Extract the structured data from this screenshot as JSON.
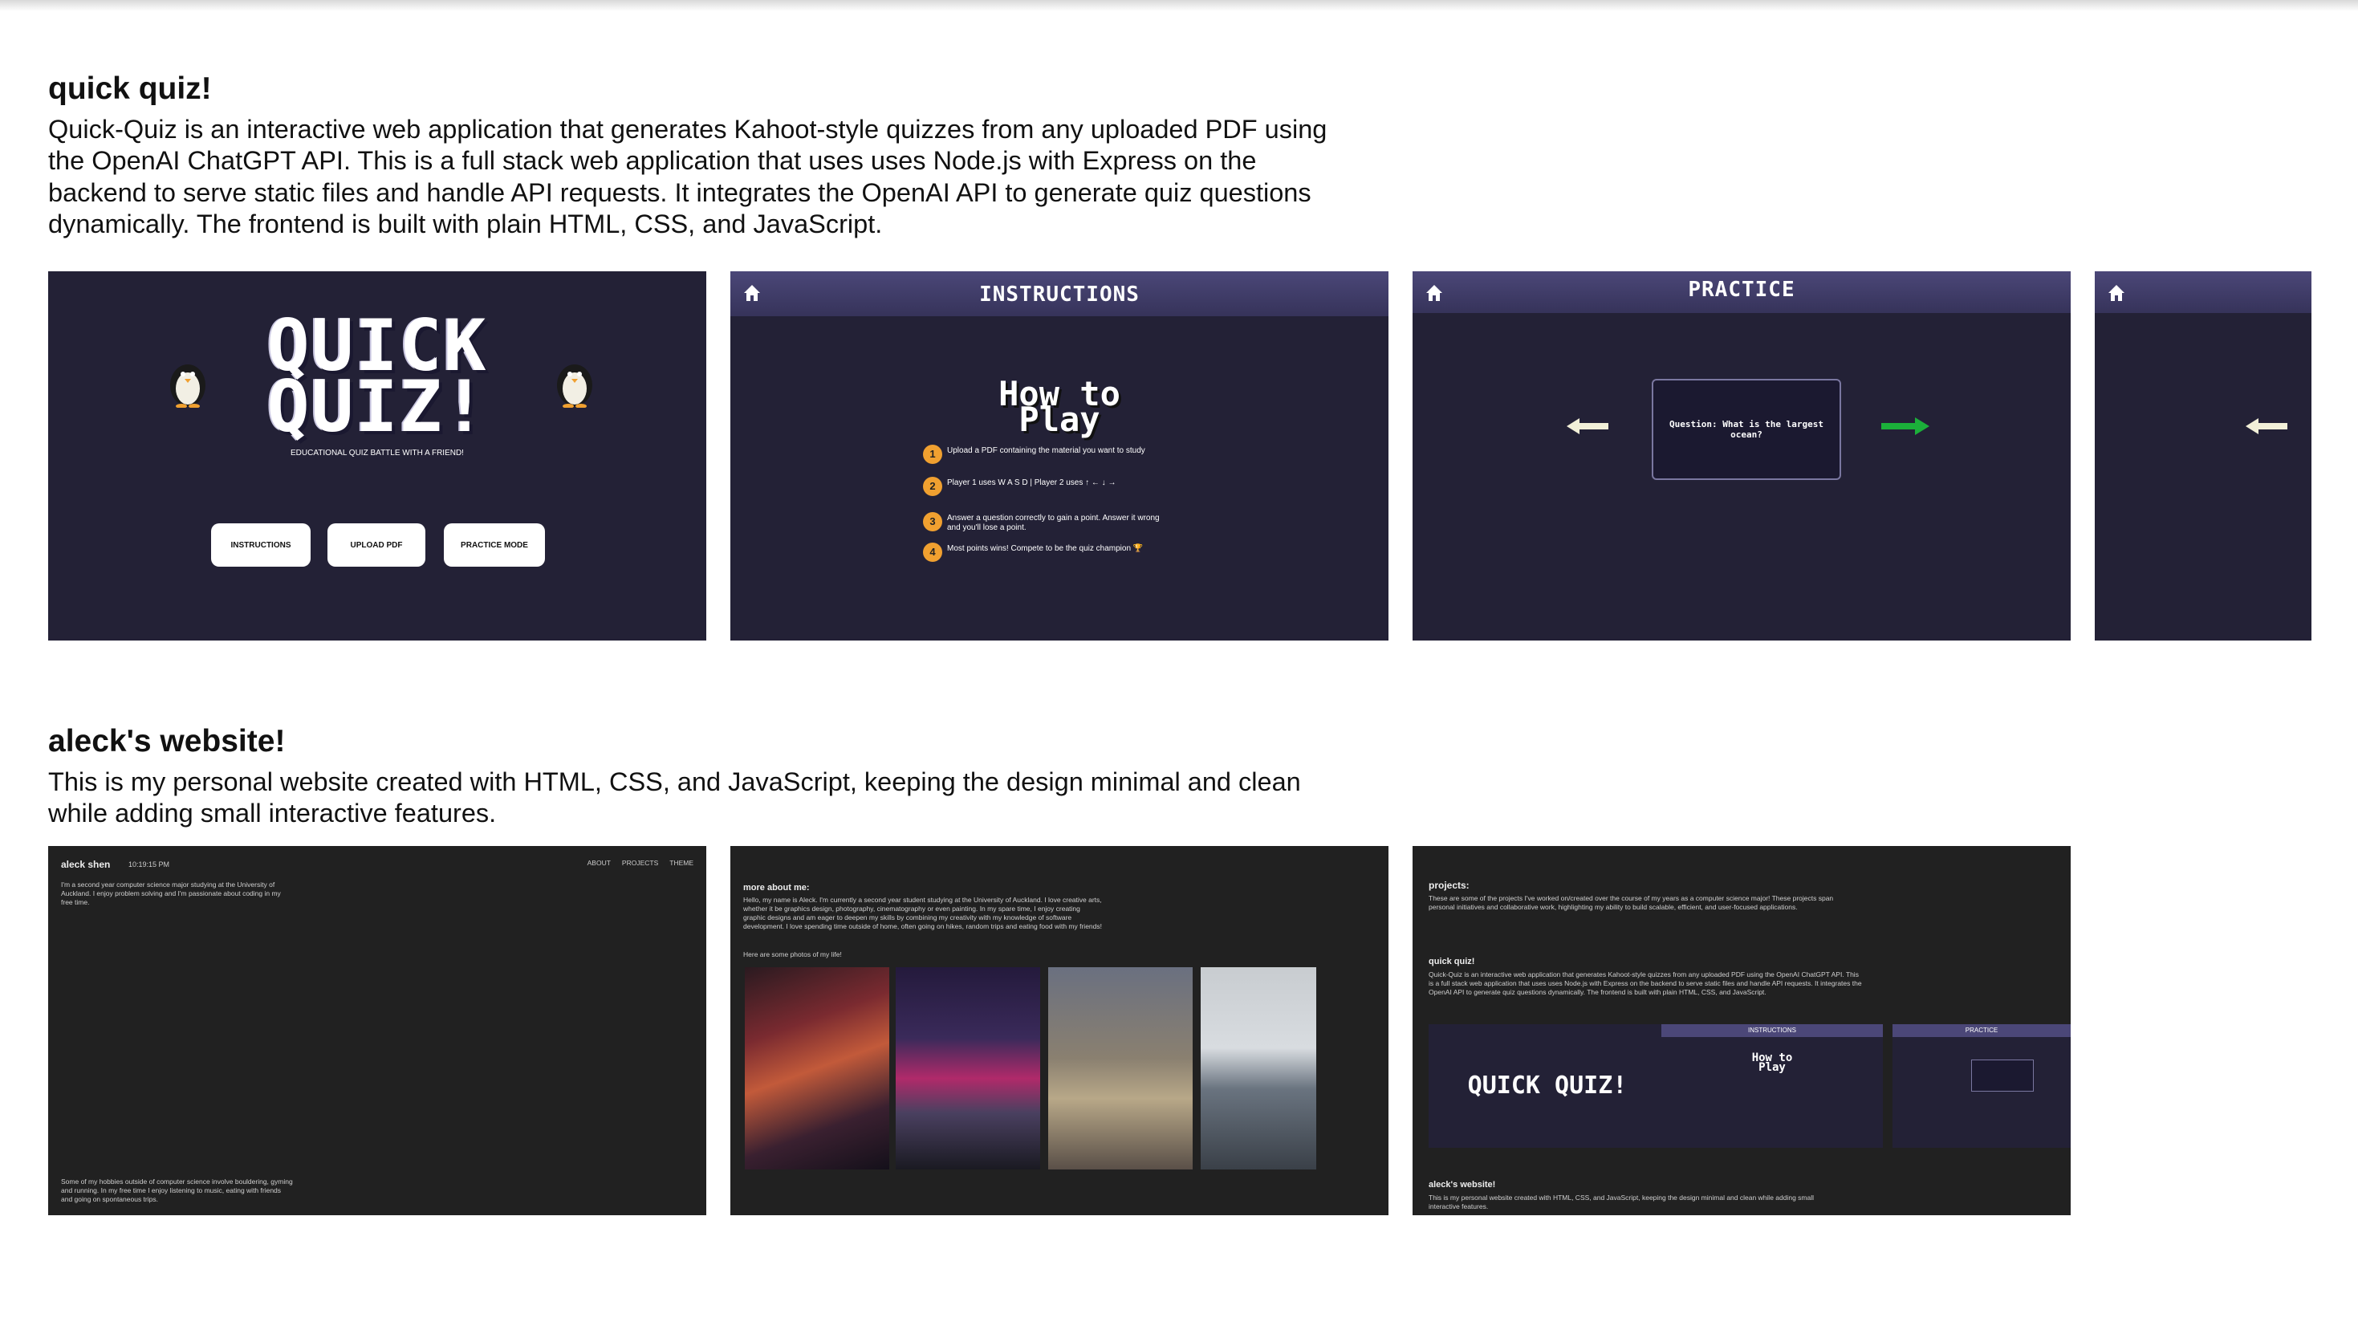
{
  "projects": [
    {
      "title": "quick quiz!",
      "description": "Quick-Quiz is an interactive web application that generates Kahoot-style quizzes from any uploaded PDF using the OpenAI ChatGPT API. This is a full stack web application that uses uses Node.js with Express on the backend to serve static files and handle API requests. It integrates the OpenAI API to generate quiz questions dynamically. The frontend is built with plain HTML, CSS, and JavaScript.",
      "screens": {
        "home": {
          "title": "QUICK QUIZ!",
          "subtitle": "EDUCATIONAL QUIZ BATTLE WITH A FRIEND!",
          "buttons": [
            "INSTRUCTIONS",
            "UPLOAD PDF",
            "PRACTICE MODE"
          ]
        },
        "instructions": {
          "header": "INSTRUCTIONS",
          "heading": "How to Play",
          "steps": [
            "Upload a PDF containing the material you want to study",
            "Player 1 uses W A S D  |  Player 2 uses ↑ ← ↓ →",
            "Answer a question correctly to gain a point. Answer it wrong and you'll lose a point.",
            "Most points wins! Compete to be the quiz champion 🏆"
          ],
          "step_numbers": [
            "1",
            "2",
            "3",
            "4"
          ]
        },
        "practice": {
          "header": "PRACTICE",
          "question": "Question: What is the largest ocean?"
        }
      }
    },
    {
      "title": "aleck's website!",
      "description": "This is my personal website created with HTML, CSS, and JavaScript, keeping the design minimal and clean while adding small interactive features.",
      "screens": {
        "home": {
          "name": "aleck shen",
          "time": "10:19:15 PM",
          "nav": [
            "ABOUT",
            "PROJECTS",
            "THEME"
          ],
          "intro": "I'm a second year computer science major studying at the University of Auckland. I enjoy problem solving and I'm passionate about coding in my free time.",
          "hobbies": "Some of my hobbies outside of computer science involve bouldering, gyming and running. In my free time I enjoy listening to music, eating with friends and going on spontaneous trips."
        },
        "about": {
          "heading": "more about me:",
          "body": "Hello, my name is Aleck. I'm currently a second year student studying at the University of Auckland. I love creative arts, whether it be graphics design, photography, cinematography or even painting. In my spare time, I enjoy creating graphic designs and am eager to deepen my skills by combining my creativity with my knowledge of software development. I love spending time outside of home, often going on hikes, random trips and eating food with my friends!",
          "photos_caption": "Here are some photos of my life!"
        },
        "projects": {
          "heading": "projects:",
          "intro": "These are some of the projects I've worked on/created over the course of my years as a computer science major! These projects span personal initiatives and collaborative work, highlighting my ability to build scalable, efficient, and user-focused applications.",
          "item_title": "quick quiz!",
          "item_desc": "Quick-Quiz is an interactive web application that generates Kahoot-style quizzes from any uploaded PDF using the OpenAI ChatGPT API. This is a full stack web application that uses uses Node.js with Express on the backend to serve static files and handle API requests. It integrates the OpenAI API to generate quiz questions dynamically. The frontend is built with plain HTML, CSS, and JavaScript.",
          "mini_title": "QUICK QUIZ!",
          "mini_instr": "INSTRUCTIONS",
          "mini_howto": "How to Play",
          "mini_practice": "PRACTICE",
          "next_title": "aleck's website!",
          "next_desc": "This is my personal website created with HTML, CSS, and JavaScript, keeping the design minimal and clean while adding small interactive features."
        }
      }
    }
  ]
}
